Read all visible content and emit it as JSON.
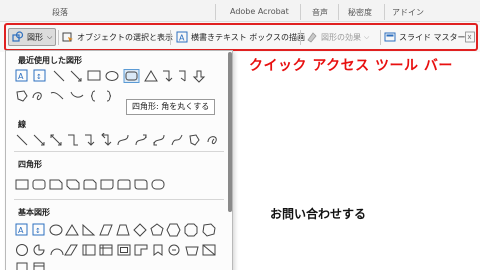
{
  "ribbon": {
    "groups": [
      "段落",
      "Adobe Acrobat",
      "音声",
      "秘密度",
      "アドイン"
    ]
  },
  "quick_access": {
    "items": [
      {
        "label": "図形",
        "icon": "shapes-icon",
        "has_dropdown": true
      },
      {
        "label": "オブジェクトの選択と表示",
        "icon": "selection-pane-icon"
      },
      {
        "label": "横書きテキスト ボックスの描画",
        "icon": "text-box-icon"
      },
      {
        "label": "図形の効果",
        "icon": "shape-effects-icon",
        "disabled": true,
        "has_dropdown": true
      },
      {
        "label": "スライド マスター",
        "icon": "slide-master-icon"
      }
    ],
    "caption": "クイック アクセス ツール バー"
  },
  "shapes_panel": {
    "sections": [
      {
        "title": "最近使用した図形"
      },
      {
        "title": "線"
      },
      {
        "title": "四角形"
      },
      {
        "title": "基本図形"
      }
    ],
    "tooltip": "四角形: 角を丸くする"
  },
  "slide": {
    "contact_text": "お問い合わせする"
  },
  "colors": {
    "highlight": "#e02020",
    "caption": "#e81010"
  }
}
